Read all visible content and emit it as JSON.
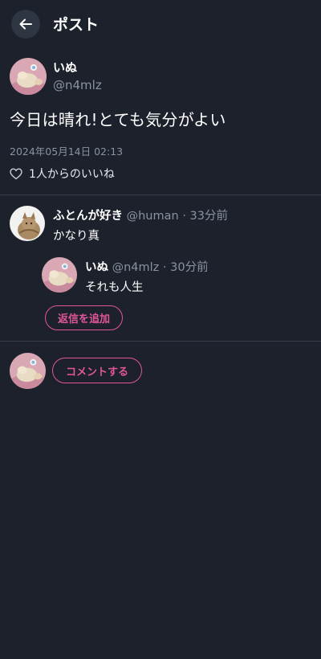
{
  "header": {
    "title": "ポスト",
    "back_icon": "arrow-left-icon"
  },
  "post": {
    "author_name": "いぬ",
    "author_handle": "@n4mlz",
    "text": "今日は晴れ!とても気分がよい",
    "date": "2024年05月14日 02:13",
    "like_icon": "heart-outline-icon",
    "like_text": "1人からのいいね"
  },
  "comment": {
    "author_name": "ふとんが好き",
    "author_handle": "@human",
    "time_ago": "· 33分前",
    "text": "かなり真"
  },
  "reply": {
    "author_name": "いぬ",
    "author_handle": "@n4mlz",
    "time_ago": "· 30分前",
    "text": "それも人生",
    "add_reply_label": "返信を追加"
  },
  "composer": {
    "comment_label": "コメントする"
  },
  "colors": {
    "background": "#1c212b",
    "accent": "#e0569a",
    "muted_text": "#8b93a3",
    "divider": "#353c4a"
  }
}
